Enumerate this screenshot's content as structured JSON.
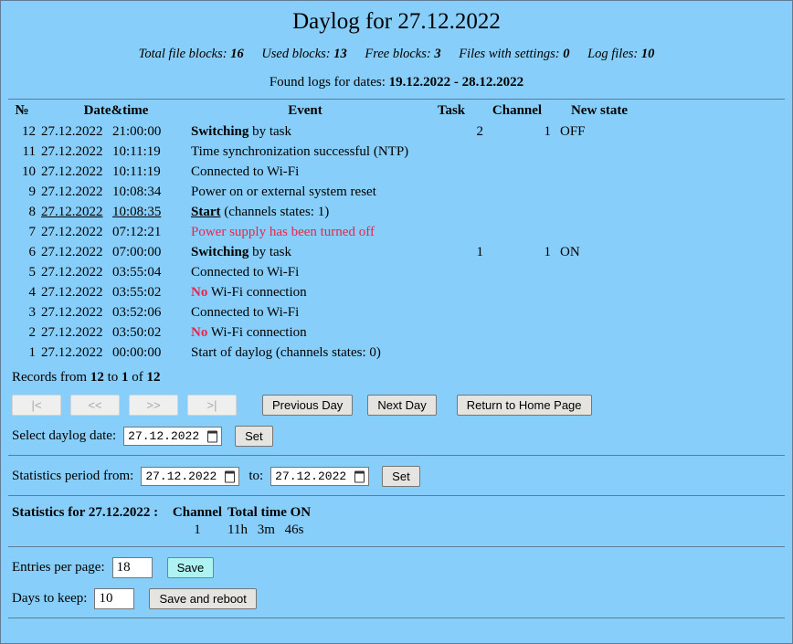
{
  "header": {
    "title": "Daylog for 27.12.2022",
    "blocks": [
      {
        "label": "Total file blocks:",
        "value": "16"
      },
      {
        "label": "Used blocks:",
        "value": "13"
      },
      {
        "label": "Free blocks:",
        "value": "3"
      },
      {
        "label": "Files with settings:",
        "value": "0"
      },
      {
        "label": "Log files:",
        "value": "10"
      }
    ],
    "found_label": "Found logs for dates:",
    "found_value": "19.12.2022 - 28.12.2022"
  },
  "table": {
    "columns": [
      "№",
      "Date&time",
      "Event",
      "Task",
      "Channel",
      "New state"
    ],
    "rows": [
      {
        "num": "12",
        "date": "27.12.2022",
        "time": "21:00:00",
        "event_bold": "Switching",
        "event_rest": " by task",
        "task": "2",
        "channel": "1",
        "state": "OFF",
        "style": "normal"
      },
      {
        "num": "11",
        "date": "27.12.2022",
        "time": "10:11:19",
        "event_bold": "",
        "event_rest": "Time synchronization successful (NTP)",
        "task": "",
        "channel": "",
        "state": "",
        "style": "normal"
      },
      {
        "num": "10",
        "date": "27.12.2022",
        "time": "10:11:19",
        "event_bold": "",
        "event_rest": "Connected to Wi-Fi",
        "task": "",
        "channel": "",
        "state": "",
        "style": "normal"
      },
      {
        "num": "9",
        "date": "27.12.2022",
        "time": "10:08:34",
        "event_bold": "",
        "event_rest": "Power on or external system reset",
        "task": "",
        "channel": "",
        "state": "",
        "style": "normal"
      },
      {
        "num": "8",
        "date": "27.12.2022",
        "time": "10:08:35",
        "event_bold": "Start",
        "event_rest": " (channels states: 1)",
        "task": "",
        "channel": "",
        "state": "",
        "style": "start"
      },
      {
        "num": "7",
        "date": "27.12.2022",
        "time": "07:12:21",
        "event_bold": "",
        "event_rest": "Power supply has been turned off",
        "task": "",
        "channel": "",
        "state": "",
        "style": "red"
      },
      {
        "num": "6",
        "date": "27.12.2022",
        "time": "07:00:00",
        "event_bold": "Switching",
        "event_rest": " by task",
        "task": "1",
        "channel": "1",
        "state": "ON",
        "style": "normal"
      },
      {
        "num": "5",
        "date": "27.12.2022",
        "time": "03:55:04",
        "event_bold": "",
        "event_rest": "Connected to Wi-Fi",
        "task": "",
        "channel": "",
        "state": "",
        "style": "normal"
      },
      {
        "num": "4",
        "date": "27.12.2022",
        "time": "03:55:02",
        "event_bold": "No",
        "event_rest": " Wi-Fi connection",
        "task": "",
        "channel": "",
        "state": "",
        "style": "redbold"
      },
      {
        "num": "3",
        "date": "27.12.2022",
        "time": "03:52:06",
        "event_bold": "",
        "event_rest": "Connected to Wi-Fi",
        "task": "",
        "channel": "",
        "state": "",
        "style": "normal"
      },
      {
        "num": "2",
        "date": "27.12.2022",
        "time": "03:50:02",
        "event_bold": "No",
        "event_rest": " Wi-Fi connection",
        "task": "",
        "channel": "",
        "state": "",
        "style": "redbold"
      },
      {
        "num": "1",
        "date": "27.12.2022",
        "time": "00:00:00",
        "event_bold": "",
        "event_rest": "Start of daylog (channels states: 0)",
        "task": "",
        "channel": "",
        "state": "",
        "style": "normal"
      }
    ]
  },
  "records": {
    "prefix": "Records from ",
    "from": "12",
    "mid": " to ",
    "to": "1",
    "suffix": " of ",
    "total": "12"
  },
  "pagination": {
    "first": "|<",
    "prev": "<<",
    "next": ">>",
    "last": ">|",
    "previous_day": "Previous Day",
    "next_day": "Next Day",
    "home": "Return to Home Page"
  },
  "daylog_select": {
    "label": "Select daylog date:",
    "value": "27.12.2022",
    "set": "Set"
  },
  "statistics_period": {
    "label": "Statistics period from:",
    "from_value": "27.12.2022",
    "to_label": "to:",
    "to_value": "27.12.2022",
    "set": "Set"
  },
  "statistics": {
    "title": "Statistics for 27.12.2022 :",
    "col_channel": "Channel",
    "col_total": "Total time ON",
    "channel": "1",
    "hours": "11h",
    "minutes": "3m",
    "seconds": "46s"
  },
  "settings": {
    "entries_label": "Entries per page:",
    "entries_value": "18",
    "entries_save": "Save",
    "days_label": "Days to keep:",
    "days_value": "10",
    "days_save": "Save and reboot"
  },
  "colors": {
    "background": "#87cefa",
    "border": "#5e7d94",
    "alert_red": "#e8264a",
    "save_highlight": "#b0f2f2"
  }
}
